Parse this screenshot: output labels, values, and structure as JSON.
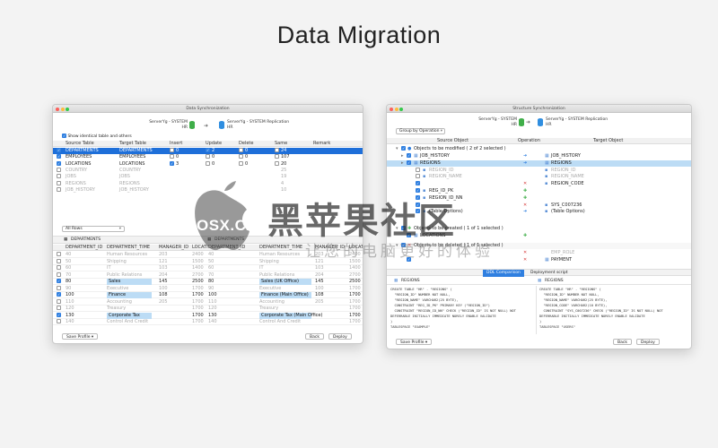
{
  "page": {
    "title": "Data Migration"
  },
  "data_sync": {
    "window_title": "Data Synchronization",
    "source": {
      "line1": "ServerYg - SYSTEM",
      "line2": "HR"
    },
    "target": {
      "line1": "ServerYg - SYSTEM Replication",
      "line2": "HR"
    },
    "show_identical_label": "Show identical table and others",
    "columns": [
      "Source Table",
      "Target Table",
      "Insert",
      "Update",
      "Delete",
      "Same",
      "Remark"
    ],
    "rows": [
      {
        "source": "DEPARTMENTS",
        "target": "DEPARTMENTS",
        "insert": "0",
        "update": "2",
        "delete": "0",
        "same": "24",
        "checked": true,
        "selected": true
      },
      {
        "source": "EMPLOYEES",
        "target": "EMPLOYEES",
        "insert": "0",
        "update": "0",
        "delete": "0",
        "same": "107",
        "checked": true,
        "selected": false
      },
      {
        "source": "LOCATIONS",
        "target": "LOCATIONS",
        "insert": "3",
        "update": "0",
        "delete": "0",
        "same": "20",
        "checked": true,
        "selected": false
      },
      {
        "source": "COUNTRY",
        "target": "COUNTRY",
        "insert": "",
        "update": "",
        "delete": "",
        "same": "25",
        "checked": false,
        "selected": false,
        "dim": true
      },
      {
        "source": "JOBS",
        "target": "JOBS",
        "insert": "",
        "update": "",
        "delete": "",
        "same": "19",
        "checked": false,
        "selected": false,
        "dim": true
      },
      {
        "source": "REGIONS",
        "target": "REGIONS",
        "insert": "",
        "update": "",
        "delete": "",
        "same": "4",
        "checked": false,
        "selected": false,
        "dim": true
      },
      {
        "source": "JOB_HISTORY",
        "target": "JOB_HISTORY",
        "insert": "",
        "update": "",
        "delete": "",
        "same": "10",
        "checked": false,
        "selected": false,
        "dim": true
      }
    ],
    "filter_value": "All Rows",
    "detail_source_label": "DEPARTMENTS",
    "detail_target_label": "DEPARTMENTS",
    "detail_columns_left": [
      "DEPARTMENT_ID",
      "DEPARTMENT_TIME",
      "MANAGER_ID",
      "LOCATI"
    ],
    "detail_columns_right": [
      "DEPARTMENT_ID",
      "DEPARTMENT_TIME",
      "MANAGER_ID",
      "LOCATI"
    ],
    "detail_rows": [
      {
        "l": [
          "40",
          "Human Resources",
          "203",
          "2400"
        ],
        "r": [
          "40",
          "Human Resources",
          "203",
          "2400"
        ],
        "check": false,
        "dim": true
      },
      {
        "l": [
          "50",
          "Shipping",
          "121",
          "1500"
        ],
        "r": [
          "50",
          "Shipping",
          "121",
          "1500"
        ],
        "check": false,
        "dim": true
      },
      {
        "l": [
          "60",
          "IT",
          "103",
          "1400"
        ],
        "r": [
          "60",
          "IT",
          "103",
          "1400"
        ],
        "check": false,
        "dim": true
      },
      {
        "l": [
          "70",
          "Public Relations",
          "204",
          "2700"
        ],
        "r": [
          "70",
          "Public Relations",
          "204",
          "2700"
        ],
        "check": false,
        "dim": true
      },
      {
        "l": [
          "80",
          "Sales",
          "145",
          "2500"
        ],
        "r": [
          "80",
          "Sales (UK Office)",
          "145",
          "2500"
        ],
        "check": true,
        "hl": true
      },
      {
        "l": [
          "90",
          "Executive",
          "100",
          "1700"
        ],
        "r": [
          "90",
          "Executive",
          "100",
          "1700"
        ],
        "check": false,
        "dim": true
      },
      {
        "l": [
          "100",
          "Finance",
          "108",
          "1700"
        ],
        "r": [
          "100",
          "Finance (Main Office)",
          "108",
          "1700"
        ],
        "check": true,
        "hl": true
      },
      {
        "l": [
          "110",
          "Accounting",
          "205",
          "1700"
        ],
        "r": [
          "110",
          "Accounting",
          "205",
          "1700"
        ],
        "check": false,
        "dim": true
      },
      {
        "l": [
          "120",
          "Treasury",
          "",
          "1700"
        ],
        "r": [
          "120",
          "Treasury",
          "",
          "1700"
        ],
        "check": false,
        "dim": true
      },
      {
        "l": [
          "130",
          "Corporate Tax",
          "",
          "1700"
        ],
        "r": [
          "130",
          "Corporate Tax (Main Office)",
          "",
          "1700"
        ],
        "check": true,
        "hl": true
      },
      {
        "l": [
          "140",
          "Control And Credit",
          "",
          "1700"
        ],
        "r": [
          "140",
          "Control And Credit",
          "",
          "1700"
        ],
        "check": false,
        "dim": true
      }
    ],
    "save_profile": "Save Profile",
    "back": "Back",
    "deploy": "Deploy"
  },
  "struct_sync": {
    "window_title": "Structure Synchronization",
    "group_by": "Group by Operation",
    "source": {
      "line1": "ServerYg - SYSTEM",
      "line2": "HR"
    },
    "target": {
      "line1": "ServerYg - SYSTEM Replication",
      "line2": "HR"
    },
    "columns": [
      "Source Object",
      "Operation",
      "Target Object"
    ],
    "modified_group": "Objects to be modified ( 2 of 2 selected )",
    "created_group": "Objects to be created ( 1 of 1 selected )",
    "deleted_group": "Objects to be deleted ( 1 of 1 selected )",
    "tree": [
      {
        "src": "JOB_HISTORY",
        "op": "arrow",
        "tgt": "JOB_HISTORY",
        "indent": 1
      },
      {
        "src": "REGIONS",
        "op": "arrow",
        "tgt": "REGIONS",
        "indent": 1,
        "hl": true
      },
      {
        "src": "REGION_ID",
        "op": "",
        "tgt": "REGION_ID",
        "indent": 2,
        "dim": true
      },
      {
        "src": "REGION_NAME",
        "op": "",
        "tgt": "REGION_NAME",
        "indent": 2,
        "dim": true
      },
      {
        "src": "",
        "op": "minus",
        "tgt": "REGION_CODE",
        "indent": 2
      },
      {
        "src": "REG_ID_PK",
        "op": "plus",
        "tgt": "",
        "indent": 2
      },
      {
        "src": "REGION_ID_NN",
        "op": "plus",
        "tgt": "",
        "indent": 2
      },
      {
        "src": "",
        "op": "minus",
        "tgt": "SYS_C007236",
        "indent": 2
      },
      {
        "src": "(Table Options)",
        "op": "arrow",
        "tgt": "(Table Options)",
        "indent": 2
      }
    ],
    "created_item": "LOCATIONS",
    "deleted_item": "PAYMENT",
    "deleted_sub": "EMP_ROLE",
    "tabs": [
      "DDL Comparison",
      "Deployment script"
    ],
    "ddl_left_title": "REGIONS",
    "ddl_right_title": "REGIONS",
    "ddl_left": [
      "CREATE TABLE \"HR\" . \"REGIONS\" (",
      "  \"REGION_ID\" NUMBER NOT NULL,",
      "  \"REGION_NAME\" VARCHAR2(25 BYTE),",
      "  CONSTRAINT \"REG_ID_PK\" PRIMARY KEY (\"REGION_ID\")",
      "  CONSTRAINT \"REGION_ID_NN\" CHECK (\"REGION_ID\" IS NOT NULL) NOT",
      "DEFERRABLE INITIALLY IMMEDIATE NORELY ENABLE VALIDATE",
      ")",
      "TABLESPACE \"EXAMPLE\""
    ],
    "ddl_right": [
      "CREATE TABLE \"HR\" . \"REGIONS\" (",
      "  \"REGION_ID\" NUMBER NOT NULL,",
      "  \"REGION_NAME\" VARCHAR2(25 BYTE),",
      "  \"REGION_CODE\" VARCHAR2(10 BYTE),",
      "  CONSTRAINT \"SYS_C007236\" CHECK (\"REGION_ID\" IS NOT NULL) NOT",
      "DEFERRABLE INITIALLY IMMEDIATE NORELY ENABLE VALIDATE",
      ")",
      "TABLESPACE \"USERS\""
    ],
    "save_profile": "Save Profile",
    "back": "Back",
    "deploy": "Deploy"
  },
  "watermark": {
    "logo_text": "OSX.CX",
    "cn_text": "黑苹果社区",
    "cn_sub": "让您的电脑更好的体验"
  },
  "colors": {
    "accent": "#2f7fe0",
    "selected_row": "#1e6fd9",
    "highlight": "#bcdcf5",
    "insert_green": "#3fae49",
    "delete_red": "#d63b3b"
  }
}
